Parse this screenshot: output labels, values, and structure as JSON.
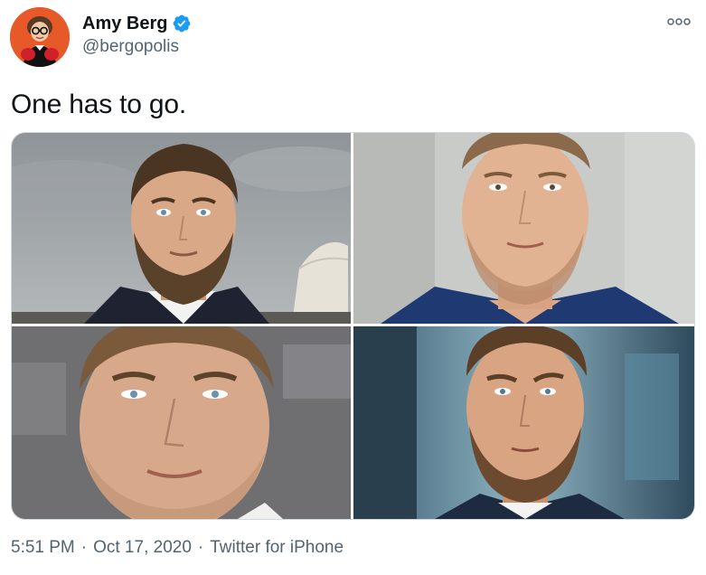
{
  "author": {
    "display_name": "Amy Berg",
    "handle": "@bergopolis",
    "verified": true,
    "avatar_icon": "avatar-photo",
    "verified_icon": "verified-badge-icon",
    "verified_color": "#1d9bf0"
  },
  "menu": {
    "icon": "more-options-icon"
  },
  "tweet": {
    "text": "One has to go."
  },
  "media": {
    "photos": [
      {
        "position": "top-left"
      },
      {
        "position": "top-right"
      },
      {
        "position": "bottom-left"
      },
      {
        "position": "bottom-right"
      }
    ]
  },
  "footer": {
    "time": "5:51 PM",
    "separator": "·",
    "date": "Oct 17, 2020",
    "source": "Twitter for iPhone"
  },
  "colors": {
    "text_primary": "#0f1419",
    "text_secondary": "#536471",
    "border": "#cfd9de",
    "avatar_bg": "#e8592a"
  }
}
